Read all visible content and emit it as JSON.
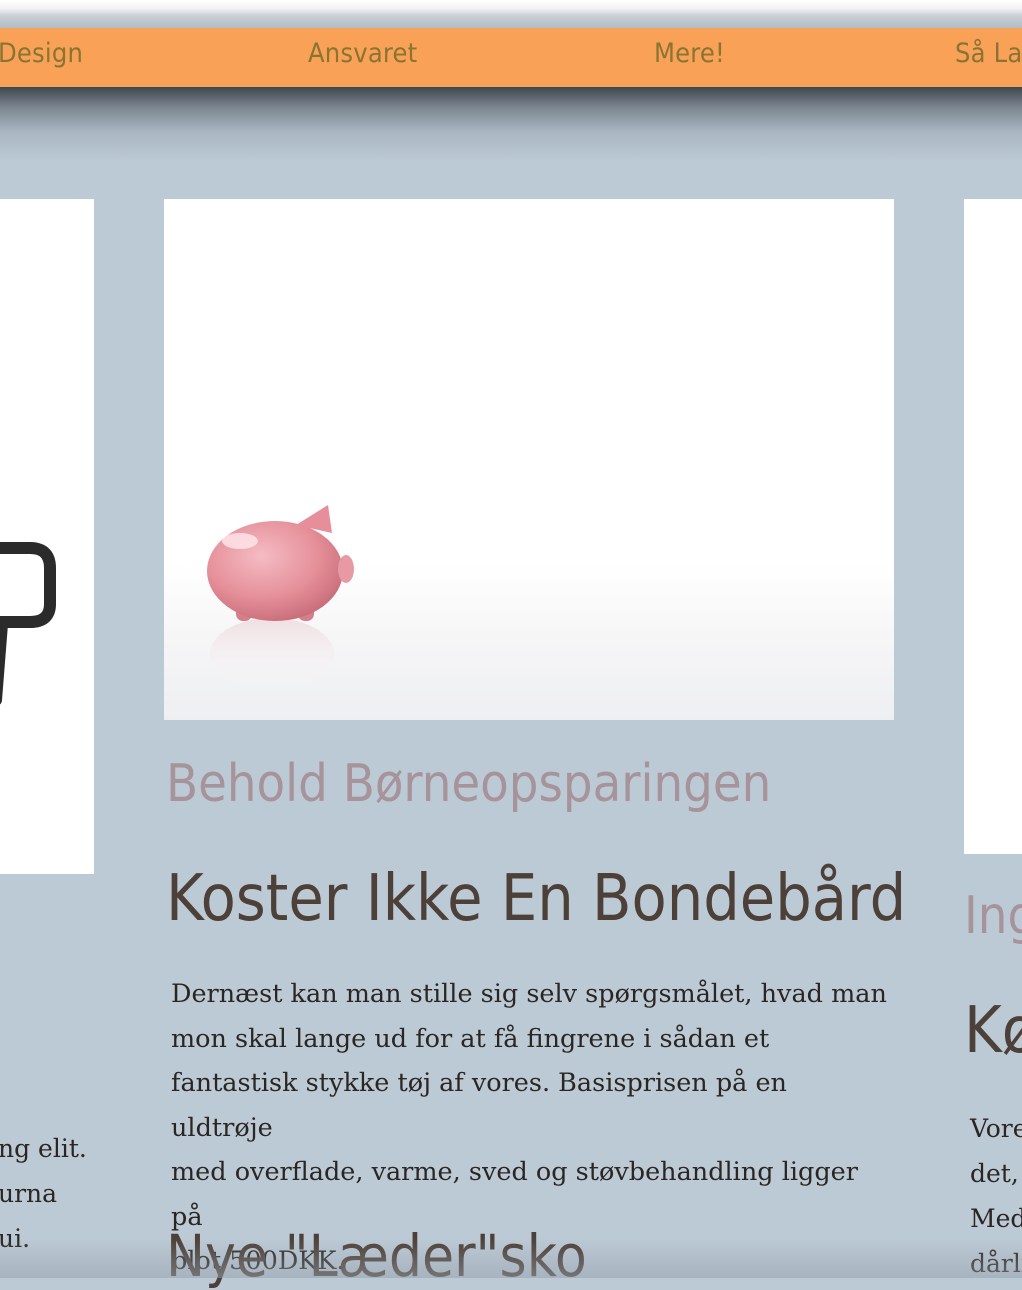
{
  "nav": {
    "items": [
      {
        "label": "Design"
      },
      {
        "label": "Ansvaret"
      },
      {
        "label": "Mere!"
      },
      {
        "label": "Så La"
      }
    ]
  },
  "main_article": {
    "kicker": "Behold Børneopsparingen",
    "headline": "Koster Ikke En Bondebård",
    "body_lines": [
      "Dernæst kan man stille sig selv spørgsmålet, hvad man",
      "mon skal lange ud for at få fingrene i sådan et",
      "fantastisk stykke tøj af vores. Basisprisen på en uldtrøje",
      "med overflade, varme, sved og støvbehandling ligger på",
      "blot 500DKK."
    ],
    "subhead": "Nye \"Læder\"sko"
  },
  "left_article": {
    "body_lines": [
      "ng elit.",
      "urna",
      "ui."
    ]
  },
  "right_article": {
    "kicker": "Ing",
    "headline": "Kø",
    "body_lines": [
      "Vore",
      "det,",
      "Med",
      "dårli"
    ]
  },
  "colors": {
    "page_bg": "#bccad6",
    "nav_bg": "#f9a257",
    "nav_text": "#8a7433",
    "kicker": "#a7939a",
    "headline": "#4d4038"
  },
  "icons": {
    "left_card_image": "logo-fragment-icon",
    "main_card_image": "piggy-bank-image"
  }
}
